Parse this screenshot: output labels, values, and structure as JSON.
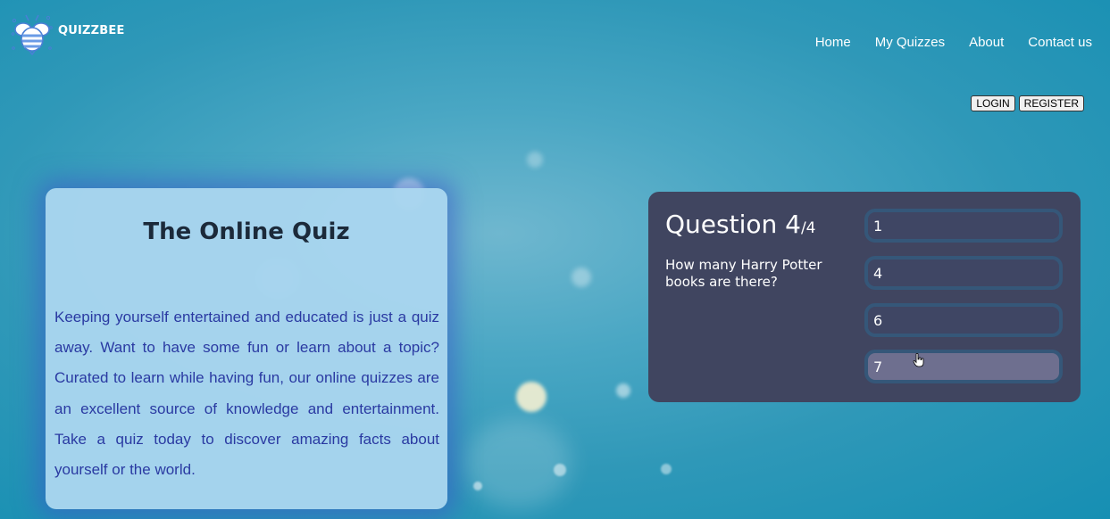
{
  "brand": {
    "name": "QUIZZBEE"
  },
  "nav": {
    "items": [
      {
        "label": "Home"
      },
      {
        "label": "My Quizzes"
      },
      {
        "label": "About"
      },
      {
        "label": "Contact us"
      }
    ]
  },
  "auth": {
    "login_label": "LOGIN",
    "register_label": "REGISTER"
  },
  "intro": {
    "title": "The Online Quiz",
    "text": "Keeping yourself entertained and educated is just a quiz away. Want to have some fun or learn about a topic? Curated to learn while having fun, our online quizzes are an excellent source of knowledge and entertainment. Take a quiz today to discover amazing facts about yourself or the world."
  },
  "quiz": {
    "question_label": "Question 4",
    "question_total": "/4",
    "question_text": "How many Harry Potter books are there?",
    "answers": [
      {
        "label": "1"
      },
      {
        "label": "4"
      },
      {
        "label": "6"
      },
      {
        "label": "7",
        "hovered": true
      }
    ]
  },
  "colors": {
    "card_background": "#a8d5ee",
    "card_text": "#2a3aa2",
    "quiz_background": "#404560",
    "answer_border": "#355779",
    "answer_hover": "#6e6f8f"
  }
}
